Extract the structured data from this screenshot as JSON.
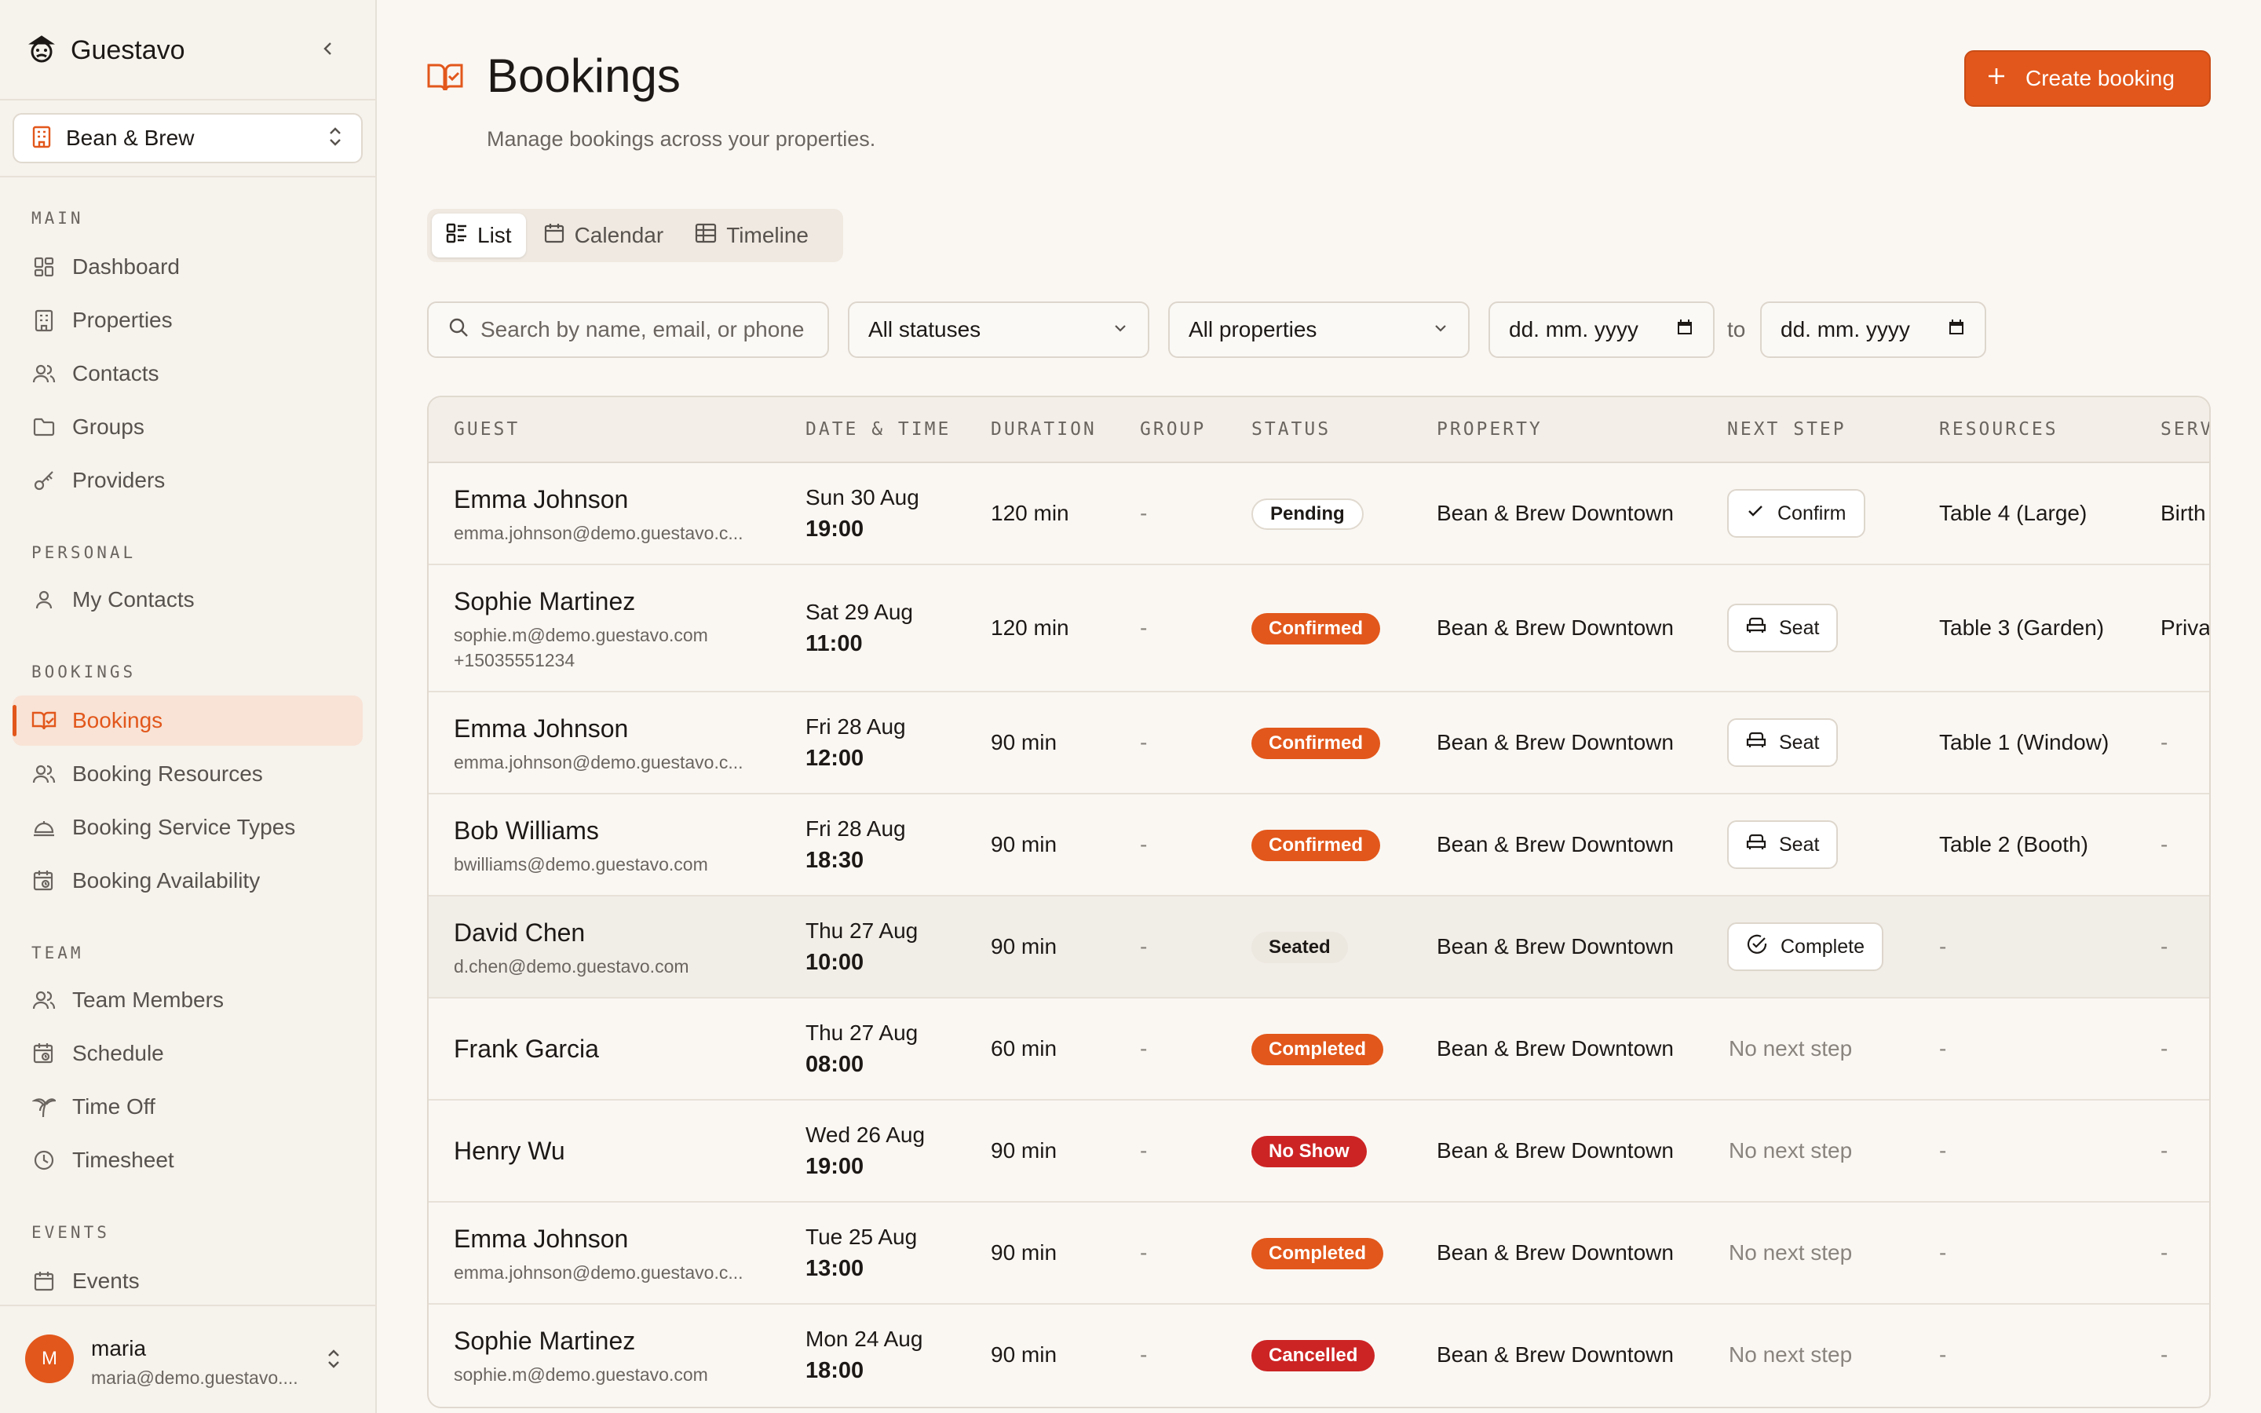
{
  "app": {
    "name": "Guestavo"
  },
  "property_selector": {
    "value": "Bean & Brew"
  },
  "nav": {
    "sections": [
      "MAIN",
      "PERSONAL",
      "BOOKINGS",
      "TEAM",
      "EVENTS"
    ],
    "items": [
      {
        "label": "Dashboard"
      },
      {
        "label": "Properties"
      },
      {
        "label": "Contacts"
      },
      {
        "label": "Groups"
      },
      {
        "label": "Providers"
      },
      {
        "label": "My Contacts"
      },
      {
        "label": "Bookings"
      },
      {
        "label": "Booking Resources"
      },
      {
        "label": "Booking Service Types"
      },
      {
        "label": "Booking Availability"
      },
      {
        "label": "Team Members"
      },
      {
        "label": "Schedule"
      },
      {
        "label": "Time Off"
      },
      {
        "label": "Timesheet"
      },
      {
        "label": "Events"
      }
    ]
  },
  "user": {
    "initial": "M",
    "name": "maria",
    "email": "maria@demo.guestavo...."
  },
  "page": {
    "title": "Bookings",
    "subtitle": "Manage bookings across your properties.",
    "create_label": "Create booking"
  },
  "views": [
    {
      "label": "List"
    },
    {
      "label": "Calendar"
    },
    {
      "label": "Timeline"
    }
  ],
  "filters": {
    "search_placeholder": "Search by name, email, or phone",
    "status": "All statuses",
    "property": "All properties",
    "date_from": "dd. mm. yyyy",
    "to": "to",
    "date_to": "dd. mm. yyyy"
  },
  "table": {
    "headers": [
      "GUEST",
      "DATE & TIME",
      "DURATION",
      "GROUP",
      "STATUS",
      "PROPERTY",
      "NEXT STEP",
      "RESOURCES",
      "SERV"
    ],
    "rows": [
      {
        "name": "Emma Johnson",
        "email": "emma.johnson@demo.guestavo.c...",
        "phone": "",
        "date": "Sun 30 Aug",
        "time": "19:00",
        "duration": "120 min",
        "group": "-",
        "status": "Pending",
        "property": "Bean & Brew Downtown",
        "next": "Confirm",
        "resources": "Table 4 (Large)",
        "service": "Birth"
      },
      {
        "name": "Sophie Martinez",
        "email": "sophie.m@demo.guestavo.com",
        "phone": "+15035551234",
        "date": "Sat 29 Aug",
        "time": "11:00",
        "duration": "120 min",
        "group": "-",
        "status": "Confirmed",
        "property": "Bean & Brew Downtown",
        "next": "Seat",
        "resources": "Table 3 (Garden)",
        "service": "Priva"
      },
      {
        "name": "Emma Johnson",
        "email": "emma.johnson@demo.guestavo.c...",
        "phone": "",
        "date": "Fri 28 Aug",
        "time": "12:00",
        "duration": "90 min",
        "group": "-",
        "status": "Confirmed",
        "property": "Bean & Brew Downtown",
        "next": "Seat",
        "resources": "Table 1 (Window)",
        "service": "-"
      },
      {
        "name": "Bob Williams",
        "email": "bwilliams@demo.guestavo.com",
        "phone": "",
        "date": "Fri 28 Aug",
        "time": "18:30",
        "duration": "90 min",
        "group": "-",
        "status": "Confirmed",
        "property": "Bean & Brew Downtown",
        "next": "Seat",
        "resources": "Table 2 (Booth)",
        "service": "-"
      },
      {
        "name": "David Chen",
        "email": "d.chen@demo.guestavo.com",
        "phone": "",
        "date": "Thu 27 Aug",
        "time": "10:00",
        "duration": "90 min",
        "group": "-",
        "status": "Seated",
        "property": "Bean & Brew Downtown",
        "next": "Complete",
        "resources": "-",
        "service": "-"
      },
      {
        "name": "Frank Garcia",
        "email": "",
        "phone": "",
        "date": "Thu 27 Aug",
        "time": "08:00",
        "duration": "60 min",
        "group": "-",
        "status": "Completed",
        "property": "Bean & Brew Downtown",
        "next": "No next step",
        "resources": "-",
        "service": "-"
      },
      {
        "name": "Henry Wu",
        "email": "",
        "phone": "",
        "date": "Wed 26 Aug",
        "time": "19:00",
        "duration": "90 min",
        "group": "-",
        "status": "No Show",
        "property": "Bean & Brew Downtown",
        "next": "No next step",
        "resources": "-",
        "service": "-"
      },
      {
        "name": "Emma Johnson",
        "email": "emma.johnson@demo.guestavo.c...",
        "phone": "",
        "date": "Tue 25 Aug",
        "time": "13:00",
        "duration": "90 min",
        "group": "-",
        "status": "Completed",
        "property": "Bean & Brew Downtown",
        "next": "No next step",
        "resources": "-",
        "service": "-"
      },
      {
        "name": "Sophie Martinez",
        "email": "sophie.m@demo.guestavo.com",
        "phone": "",
        "date": "Mon 24 Aug",
        "time": "18:00",
        "duration": "90 min",
        "group": "-",
        "status": "Cancelled",
        "property": "Bean & Brew Downtown",
        "next": "No next step",
        "resources": "-",
        "service": "-"
      }
    ]
  },
  "colors": {
    "accent": "#e2571b",
    "danger": "#cc2424",
    "background": "#faf7f3",
    "sidebar": "#f6f2ec"
  },
  "icons": [
    "guestavo-logo-icon",
    "chevron-left-icon",
    "building-icon",
    "chevron-updown-icon",
    "dashboard-icon",
    "properties-icon",
    "contacts-icon",
    "folder-icon",
    "key-icon",
    "user-icon",
    "book-icon",
    "users-icon",
    "service-bell-icon",
    "calendar-clock-icon",
    "palm-tree-icon",
    "clock-icon",
    "calendar-icon",
    "plus-icon",
    "list-icon",
    "grid-icon",
    "search-icon",
    "chevron-down-icon",
    "check-icon",
    "seat-icon",
    "check-circle-icon"
  ]
}
